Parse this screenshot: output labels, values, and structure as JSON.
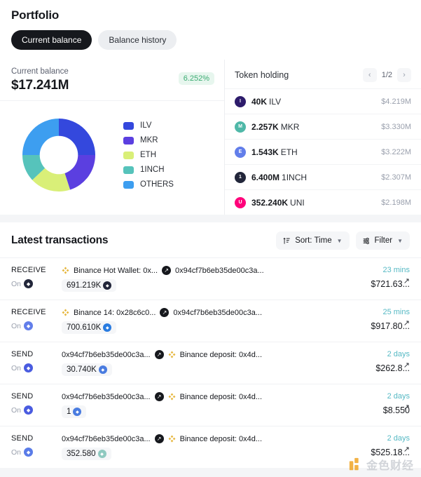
{
  "header": {
    "title": "Portfolio",
    "tabs": [
      {
        "label": "Current balance",
        "active": true
      },
      {
        "label": "Balance history",
        "active": false
      }
    ]
  },
  "balance_card": {
    "label": "Current balance",
    "value": "$17.241M",
    "change_badge": "6.252%",
    "change_color": "#3bab72"
  },
  "token_holding": {
    "title": "Token holding",
    "pager": {
      "prev": "‹",
      "page": "1/2",
      "next": "›"
    },
    "rows": [
      {
        "amount": "40K",
        "symbol": "ILV",
        "usd": "$4.219M",
        "icon": "ilv-icon",
        "color": "#2d1b6b"
      },
      {
        "amount": "2.257K",
        "symbol": "MKR",
        "usd": "$3.330M",
        "icon": "mkr-icon",
        "color": "#4fb8a8"
      },
      {
        "amount": "1.543K",
        "symbol": "ETH",
        "usd": "$3.222M",
        "icon": "eth-icon",
        "color": "#627eea"
      },
      {
        "amount": "6.400M",
        "symbol": "1INCH",
        "usd": "$2.307M",
        "icon": "1inch-icon",
        "color": "#22263a"
      },
      {
        "amount": "352.240K",
        "symbol": "UNI",
        "usd": "$2.198M",
        "icon": "uni-icon",
        "color": "#ff007a"
      }
    ]
  },
  "chart_data": {
    "type": "pie",
    "title": "Current balance",
    "labels": [
      "ILV",
      "MKR",
      "ETH",
      "1INCH",
      "OTHERS"
    ],
    "values": [
      25.0,
      20.0,
      18.0,
      12.0,
      25.0
    ],
    "colors": [
      "#3448dd",
      "#5b3fe0",
      "#d9ef78",
      "#56c3bb",
      "#3d9ef0"
    ],
    "legend_position": "right",
    "donut": true,
    "inner_radius_ratio": 0.52
  },
  "transactions": {
    "title": "Latest transactions",
    "sort_label": "Sort: Time",
    "filter_label": "Filter",
    "rows": [
      {
        "type": "RECEIVE",
        "on_label": "On",
        "chain": "1inch-chain-icon",
        "chain_color": "#22263a",
        "from": "Binance Hot Wallet: 0x...",
        "from_icon": "binance-icon",
        "to": "0x94cf7b6eb35de00c3a...",
        "direction_icon": "arrow-up-right-icon",
        "amount": "691.219K",
        "amount_icon": "1inch-token-icon",
        "amount_icon_color": "#22263a",
        "time": "23 mins",
        "usd": "$721.63..."
      },
      {
        "type": "RECEIVE",
        "on_label": "On",
        "chain": "eth-chain-icon",
        "chain_color": "#627eea",
        "from": "Binance 14: 0x28c6c0...",
        "from_icon": "binance-icon",
        "to": "0x94cf7b6eb35de00c3a...",
        "direction_icon": "arrow-up-right-icon",
        "amount": "700.610K",
        "amount_icon": "eth-token-icon",
        "amount_icon_color": "#2a7ce0",
        "time": "25 mins",
        "usd": "$917.80..."
      },
      {
        "type": "SEND",
        "on_label": "On",
        "chain": "eth-chain-icon",
        "chain_color": "#4a5ce0",
        "from": "0x94cf7b6eb35de00c3a...",
        "from_icon": "none",
        "to": "Binance deposit: 0x4d...",
        "direction_icon": "arrow-up-right-icon",
        "amount": "30.740K",
        "amount_icon": "eth-token-icon",
        "amount_icon_color": "#4a7ce0",
        "time": "2 days",
        "usd": "$262.8..."
      },
      {
        "type": "SEND",
        "on_label": "On",
        "chain": "eth-chain-icon",
        "chain_color": "#4a5ce0",
        "from": "0x94cf7b6eb35de00c3a...",
        "from_icon": "none",
        "to": "Binance deposit: 0x4d...",
        "direction_icon": "arrow-up-right-icon",
        "amount": "1",
        "amount_icon": "eth-token-icon",
        "amount_icon_color": "#4a7ce0",
        "time": "2 days",
        "usd": "$8.550"
      },
      {
        "type": "SEND",
        "on_label": "On",
        "chain": "eth-chain-icon",
        "chain_color": "#5a7ce8",
        "from": "0x94cf7b6eb35de00c3a...",
        "from_icon": "none",
        "to": "Binance deposit: 0x4d...",
        "direction_icon": "arrow-up-right-icon",
        "amount": "352.580",
        "amount_icon": "mkr-token-icon",
        "amount_icon_color": "#8fc9c0",
        "time": "2 days",
        "usd": "$525.18..."
      }
    ]
  },
  "watermark": {
    "text": "金色财经"
  }
}
